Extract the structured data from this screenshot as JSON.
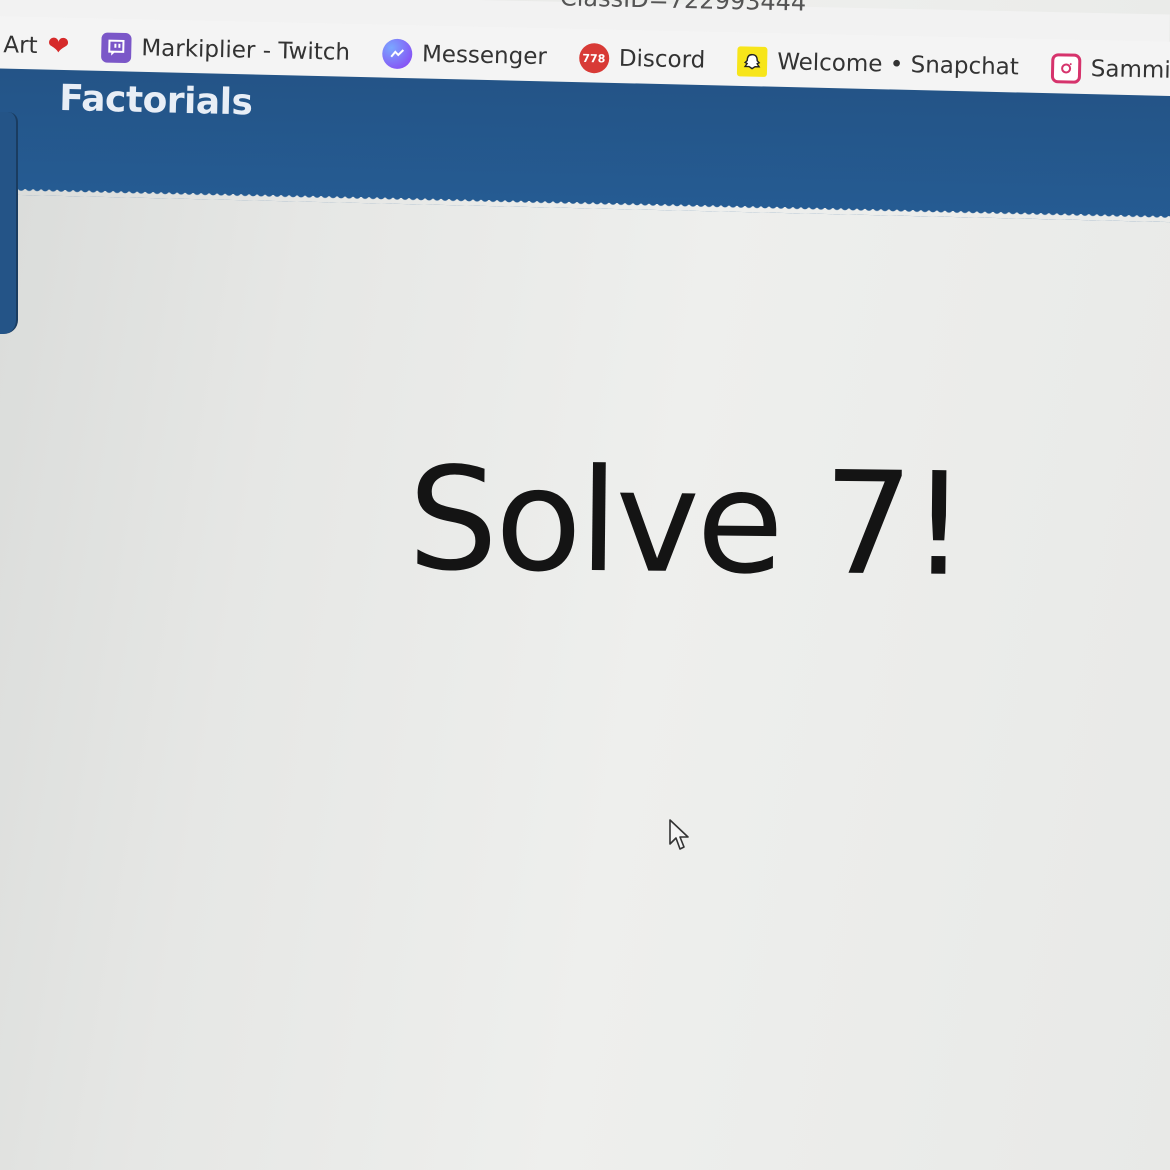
{
  "browser": {
    "url_fragment": "ClassID=722993444",
    "bookmarks": [
      {
        "label": "Art",
        "icon": "heart-icon"
      },
      {
        "label": "Markiplier - Twitch",
        "icon": "twitch-icon"
      },
      {
        "label": "Messenger",
        "icon": "messenger-icon"
      },
      {
        "label": "Discord",
        "icon": "discord-icon",
        "badge": "778"
      },
      {
        "label": "Welcome • Snapchat",
        "icon": "snapchat-icon"
      },
      {
        "label": "Sammi",
        "icon": "instagram-icon"
      }
    ]
  },
  "page": {
    "title": "Factorials",
    "problem": "Solve 7!"
  },
  "colors": {
    "header_blue": "#255b92",
    "title_text": "#e8eef6",
    "problem_text": "#141414"
  }
}
